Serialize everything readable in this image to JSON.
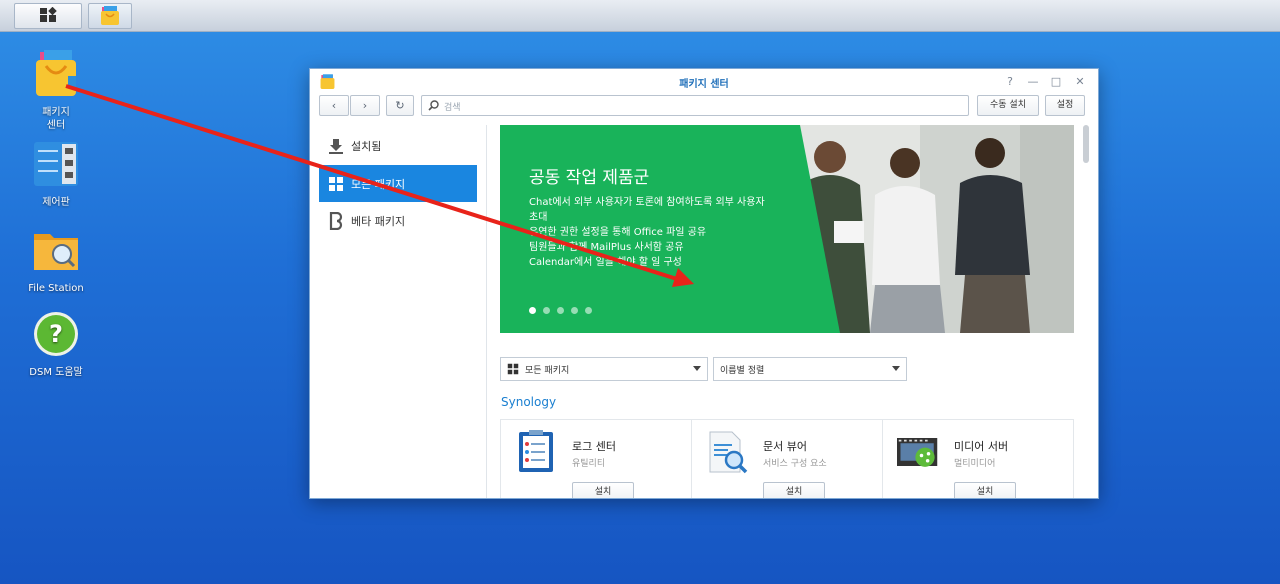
{
  "taskbar": {
    "main_menu_icon": "grid-icon",
    "pinned_app_icon": "package-center-icon"
  },
  "desktop": {
    "icons": [
      {
        "label_line1": "패키지",
        "label_line2": "센터",
        "icon": "package-center-icon"
      },
      {
        "label_line1": "제어판",
        "icon": "control-panel-icon"
      },
      {
        "label_line1": "File Station",
        "icon": "file-station-icon"
      },
      {
        "label_line1": "DSM 도움말",
        "icon": "help-icon"
      }
    ]
  },
  "window": {
    "title": "패키지 센터",
    "controls": {
      "help": "?",
      "minimize": "—",
      "maximize": "□",
      "close": "✕"
    },
    "toolbar": {
      "back": "‹",
      "forward": "›",
      "refresh": "↻",
      "search_placeholder": "검색",
      "manual_install": "수동 설치",
      "settings": "설정"
    },
    "sidebar": {
      "items": [
        {
          "label": "설치됨",
          "icon": "download-icon",
          "active": false
        },
        {
          "label": "모든 패키지",
          "icon": "grid-icon",
          "active": true
        },
        {
          "label": "베타 패키지",
          "icon": "beta-icon",
          "active": false
        }
      ]
    },
    "banner": {
      "title": "공동 작업 제품군",
      "lines": [
        "Chat에서 외부 사용자가 토론에 참여하도록 외부 사용자",
        "초대",
        "유연한 권한 설정을 통해 Office 파일 공유",
        "팀원들과 함께 MailPlus 사서함 공유",
        "Calendar에서 일을 해야 할 일 구성"
      ],
      "dots": 5,
      "active_dot": 0
    },
    "filters": {
      "category": "모든 패키지",
      "sort": "이름별 정렬"
    },
    "section_title": "Synology",
    "packages": [
      {
        "name": "로그 센터",
        "category": "유틸리티",
        "button": "설치",
        "icon": "log-center-icon"
      },
      {
        "name": "문서 뷰어",
        "category": "서비스 구성 요소",
        "button": "설치",
        "icon": "document-viewer-icon"
      },
      {
        "name": "미디어 서버",
        "category": "멀티미디어",
        "button": "설치",
        "icon": "media-server-icon"
      }
    ]
  },
  "colors": {
    "desktop": "#1f6fd6",
    "accent": "#1a86e0",
    "banner_green": "#19b35a",
    "annotation_arrow": "#e8231a"
  }
}
